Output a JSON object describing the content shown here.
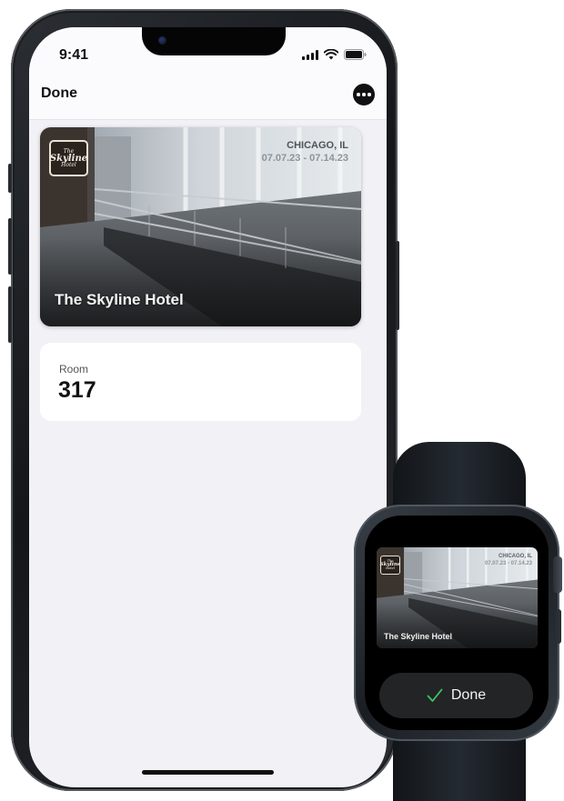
{
  "phone": {
    "status_bar": {
      "time": "9:41",
      "icons": [
        "cellular-signal-icon",
        "wifi-icon",
        "battery-icon"
      ]
    },
    "nav": {
      "done_label": "Done",
      "more_icon": "ellipsis-circle-icon"
    },
    "pass": {
      "logo": {
        "line1": "The",
        "line2": "Skyline",
        "line3": "Hotel"
      },
      "location": "CHICAGO, IL",
      "dates": "07.07.23 - 07.14.23",
      "hotel_name": "The Skyline Hotel"
    },
    "room": {
      "label": "Room",
      "value": "317"
    }
  },
  "watch": {
    "pass": {
      "logo": {
        "line1": "The",
        "line2": "Skyline",
        "line3": "Hotel"
      },
      "location": "CHICAGO, IL",
      "dates": "07.07.23 - 07.14.23",
      "hotel_name": "The Skyline Hotel"
    },
    "done_button": {
      "label": "Done",
      "icon": "checkmark-icon"
    }
  },
  "colors": {
    "screen_bg": "#f1f1f6",
    "card_bg": "#ffffff",
    "checkmark": "#3ec463",
    "device_frame": "#1a1c1f"
  }
}
